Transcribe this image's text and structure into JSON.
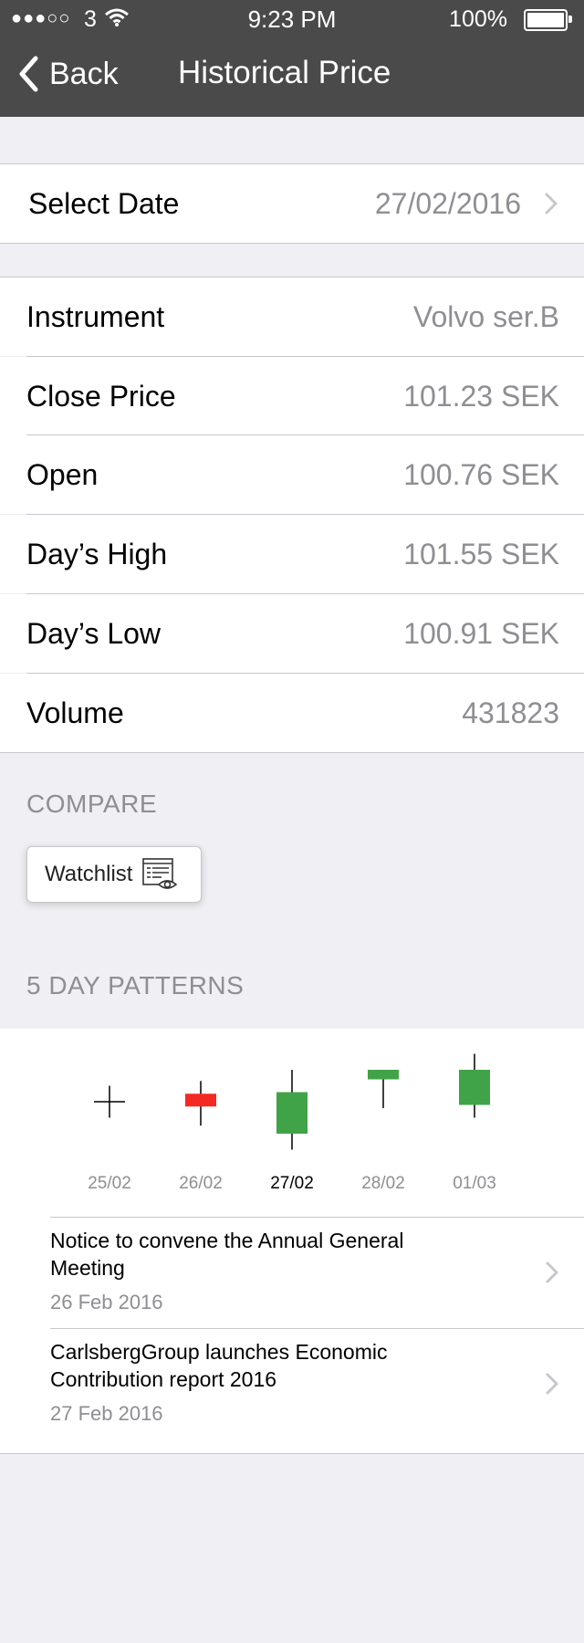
{
  "status_bar": {
    "signal": "●●●○○",
    "carrier": "3",
    "time": "9:23 PM",
    "battery": "100%"
  },
  "nav": {
    "back_label": "Back",
    "title": "Historical Price"
  },
  "select_date": {
    "label": "Select Date",
    "value": "27/02/2016"
  },
  "details": [
    {
      "label": "Instrument",
      "value": "Volvo ser.B"
    },
    {
      "label": "Close Price",
      "value": "101.23 SEK"
    },
    {
      "label": "Open",
      "value": "100.76 SEK"
    },
    {
      "label": "Day’s High",
      "value": "101.55 SEK"
    },
    {
      "label": "Day’s Low",
      "value": "100.91 SEK"
    },
    {
      "label": "Volume",
      "value": "431823"
    }
  ],
  "compare": {
    "heading": "COMPARE",
    "watchlist_label": "Watchlist"
  },
  "patterns": {
    "heading": "5 DAY PATTERNS"
  },
  "chart_data": {
    "type": "candlestick",
    "categories": [
      "25/02",
      "26/02",
      "27/02",
      "28/02",
      "01/03"
    ],
    "selected": "27/02",
    "candles": [
      {
        "open": 5.0,
        "close": 5.0,
        "high": 6.0,
        "low": 4.0,
        "direction": "flat"
      },
      {
        "open": 5.5,
        "close": 4.7,
        "high": 6.3,
        "low": 3.5,
        "direction": "down"
      },
      {
        "open": 3.0,
        "close": 5.6,
        "high": 7.0,
        "low": 2.0,
        "direction": "up"
      },
      {
        "open": 6.4,
        "close": 7.0,
        "high": 7.0,
        "low": 4.6,
        "direction": "up"
      },
      {
        "open": 4.8,
        "close": 7.0,
        "high": 8.0,
        "low": 4.0,
        "direction": "up"
      }
    ],
    "ylim": [
      1,
      9
    ],
    "colors": {
      "up": "#41a347",
      "down": "#f42a22",
      "flat": "#000000"
    }
  },
  "news": [
    {
      "title": "Notice to convene the Annual General Meeting",
      "date": "26 Feb 2016"
    },
    {
      "title": "CarlsbergGroup launches Economic Contribution report 2016",
      "date": "27 Feb 2016"
    }
  ]
}
